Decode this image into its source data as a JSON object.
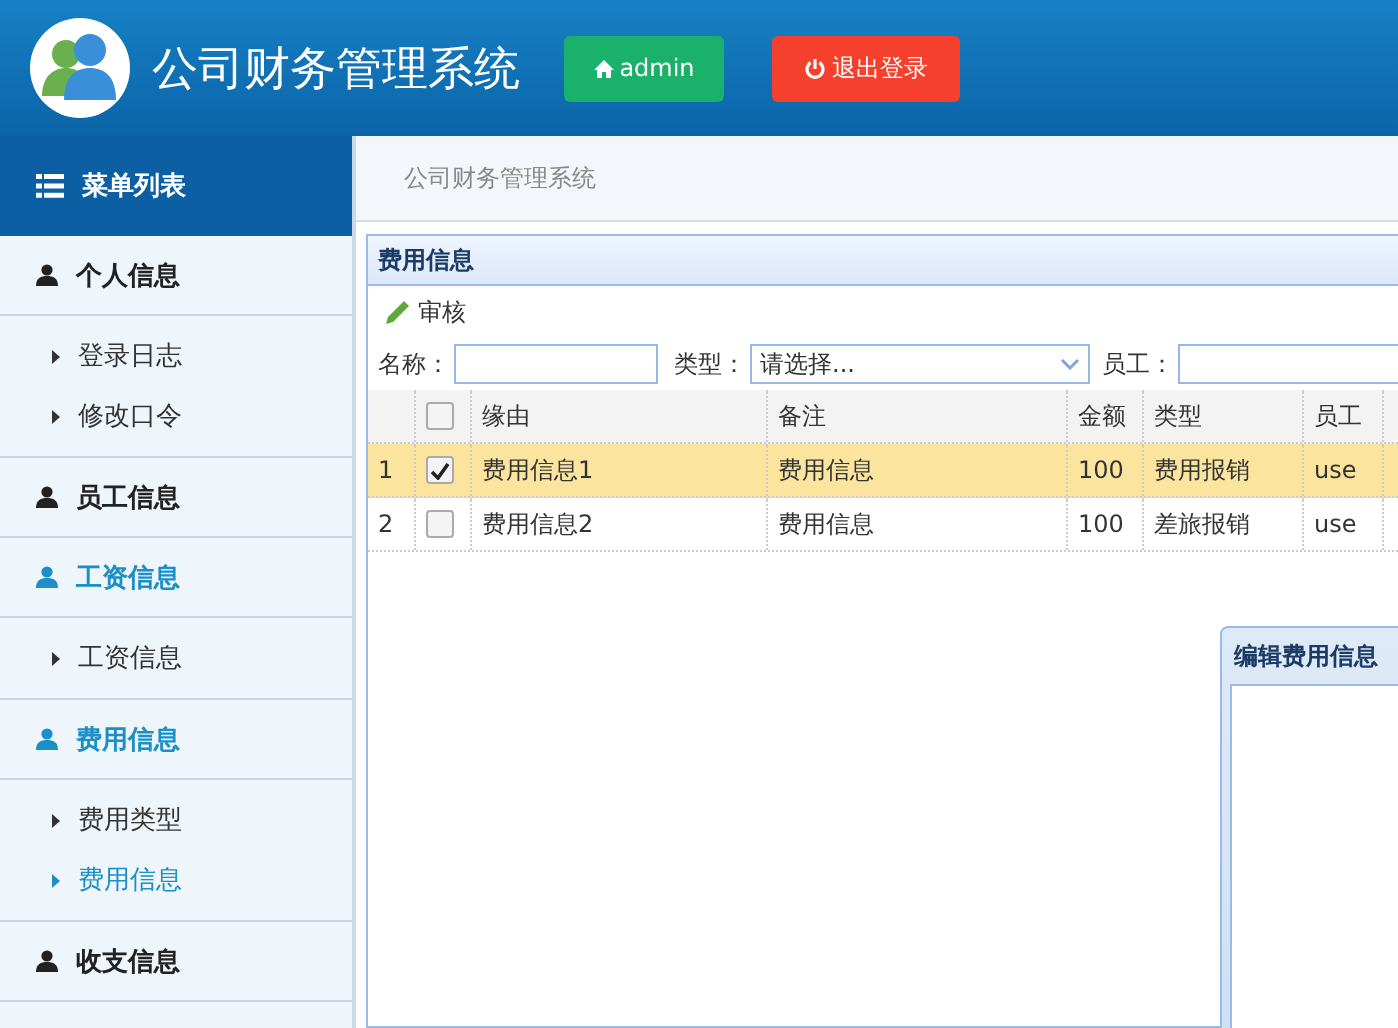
{
  "header": {
    "title": "公司财务管理系统",
    "user_button": "admin",
    "logout_button": "退出登录"
  },
  "sidebar": {
    "title": "菜单列表",
    "groups": [
      {
        "label": "个人信息",
        "selected": false,
        "children": [
          {
            "label": "登录日志",
            "selected": false
          },
          {
            "label": "修改口令",
            "selected": false
          }
        ]
      },
      {
        "label": "员工信息",
        "selected": false
      },
      {
        "label": "工资信息",
        "selected": true,
        "children": [
          {
            "label": "工资信息",
            "selected": false
          }
        ]
      },
      {
        "label": "费用信息",
        "selected": true,
        "children": [
          {
            "label": "费用类型",
            "selected": false
          },
          {
            "label": "费用信息",
            "selected": true
          }
        ]
      },
      {
        "label": "收支信息",
        "selected": false
      }
    ]
  },
  "breadcrumb": "公司财务管理系统",
  "panel": {
    "title": "费用信息",
    "toolbar": [
      "审核"
    ],
    "filters": [
      {
        "kind": "input",
        "label": "名称："
      },
      {
        "kind": "select",
        "label": "类型：",
        "placeholder": "请选择..."
      },
      {
        "kind": "input",
        "label": "员工："
      }
    ],
    "table": {
      "all_selected": false,
      "columns": [
        "缘由",
        "备注",
        "金额",
        "类型",
        "员工"
      ],
      "rows": [
        {
          "index": "1",
          "selected": true,
          "cells": [
            "费用信息1",
            "费用信息",
            "100",
            "费用报销",
            "use"
          ]
        },
        {
          "index": "2",
          "selected": false,
          "cells": [
            "费用信息2",
            "费用信息",
            "100",
            "差旅报销",
            "use"
          ]
        }
      ]
    }
  },
  "dialog": {
    "title": "编辑费用信息"
  }
}
